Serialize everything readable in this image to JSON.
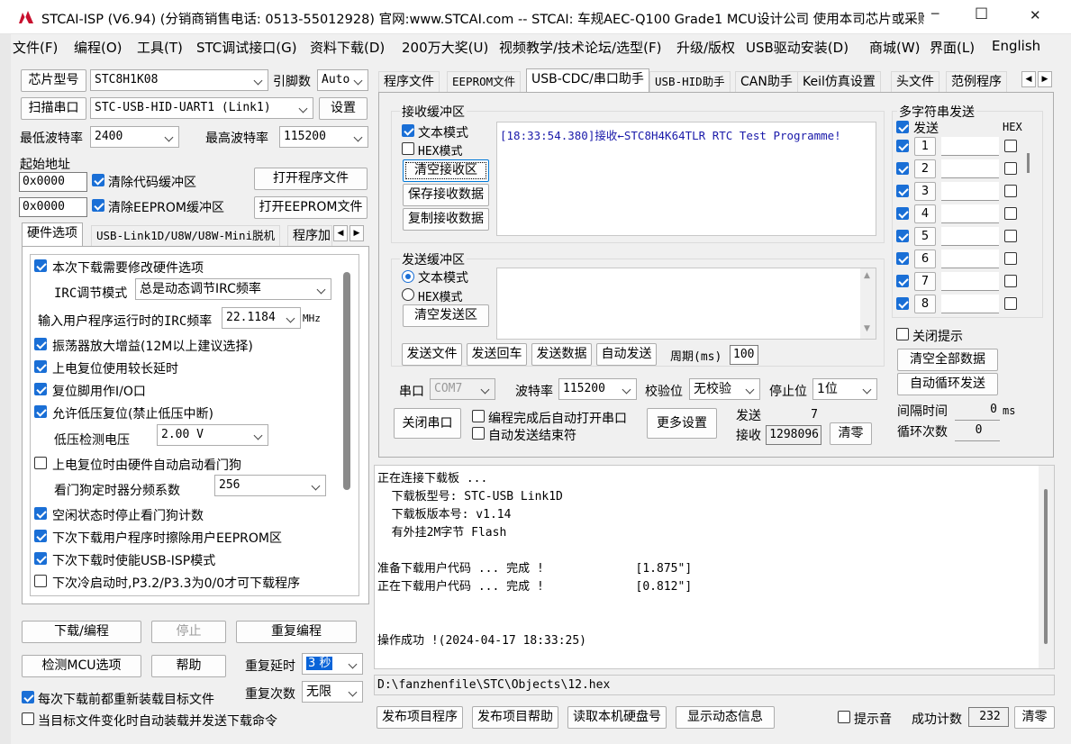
{
  "window": {
    "title": "STCAI-ISP (V6.94) (分销商销售电话: 0513-55012928) 官网:www.STCAI.com  -- STCAI: 车规AEC-Q100 Grade1 MCU设计公司 使用本司芯片或采购…",
    "app_icon": "stc-logo-icon",
    "minimize": "─",
    "maximize": "☐",
    "close": "✕"
  },
  "menu": [
    "文件(F)",
    "编程(O)",
    "工具(T)",
    "STC调试接口(G)",
    "资料下载(D)",
    "200万大奖(U)",
    "视频教学/技术论坛/选型(F)",
    "升级/版权",
    "USB驱动安装(D)",
    "商城(W)",
    "界面(L)",
    "English"
  ],
  "left": {
    "chip_label": "芯片型号",
    "chip_value": "STC8H1K08",
    "pins_label": "引脚数",
    "pins_value": "Auto",
    "scan_label": "扫描串口",
    "port_value": "STC-USB-HID-UART1 (Link1)",
    "settings_label": "设置",
    "min_baud_label": "最低波特率",
    "min_baud_value": "2400",
    "max_baud_label": "最高波特率",
    "max_baud_value": "115200",
    "start_addr_label": "起始地址",
    "addr1": "0x0000",
    "clear_code_label": "清除代码缓冲区",
    "open_prog_label": "打开程序文件",
    "addr2": "0x0000",
    "clear_eeprom_label": "清除EEPROM缓冲区",
    "open_eeprom_label": "打开EEPROM文件",
    "tabs": [
      "硬件选项",
      "USB-Link1D/U8W/U8W-Mini脱机",
      "程序加"
    ],
    "options": {
      "opt1": "本次下载需要修改硬件选项",
      "irc_mode_label": "IRC调节模式",
      "irc_mode_value": "总是动态调节IRC频率",
      "irc_freq_label": "输入用户程序运行时的IRC频率",
      "irc_freq_value": "22.1184",
      "irc_unit": "MHz",
      "opt2": "振荡器放大增益(12M以上建议选择)",
      "opt3": "上电复位使用较长延时",
      "opt4": "复位脚用作I/O口",
      "opt5": "允许低压复位(禁止低压中断)",
      "lvd_label": "低压检测电压",
      "lvd_value": "2.00 V",
      "opt6": "上电复位时由硬件自动启动看门狗",
      "wdt_label": "看门狗定时器分频系数",
      "wdt_value": "256",
      "opt7": "空闲状态时停止看门狗计数",
      "opt8": "下次下载用户程序时擦除用户EEPROM区",
      "opt9": "下次下载时使能USB-ISP模式",
      "opt10": "下次冷启动时,P3.2/P3.3为0/0才可下载程序"
    },
    "download_label": "下载/编程",
    "stop_label": "停止",
    "reprogram_label": "重复编程",
    "detect_label": "检测MCU选项",
    "help_label": "帮助",
    "repeat_delay_label": "重复延时",
    "repeat_delay_value": "3 秒",
    "repeat_count_label": "重复次数",
    "repeat_count_value": "无限",
    "reload_label": "每次下载前都重新装载目标文件",
    "auto_send_label": "当目标文件变化时自动装载并发送下载命令"
  },
  "right_tabs": [
    "程序文件",
    "EEPROM文件",
    "USB-CDC/串口助手",
    "USB-HID助手",
    "CAN助手",
    "Keil仿真设置",
    "头文件",
    "范例程序"
  ],
  "serial": {
    "recv_group": "接收缓冲区",
    "text_mode": "文本模式",
    "hex_mode": "HEX模式",
    "clear_recv": "清空接收区",
    "save_recv": "保存接收数据",
    "copy_recv": "复制接收数据",
    "recv_text": "[18:33:54.380]接收←STC8H4K64TLR RTC Test Programme!",
    "send_group": "发送缓冲区",
    "send_text_mode": "文本模式",
    "send_hex_mode": "HEX模式",
    "clear_send": "清空发送区",
    "send_file": "发送文件",
    "send_crlf": "发送回车",
    "send_data": "发送数据",
    "auto_send": "自动发送",
    "period_label": "周期(ms)",
    "period_value": "100",
    "port_label": "串口",
    "port_value": "COM7",
    "baud_label": "波特率",
    "baud_value": "115200",
    "parity_label": "校验位",
    "parity_value": "无校验",
    "stopbits_label": "停止位",
    "stopbits_value": "1位",
    "close_port": "关闭串口",
    "auto_open": "编程完成后自动打开串口",
    "auto_end": "自动发送结束符",
    "more_settings": "更多设置",
    "sent_label": "发送",
    "sent_value": "7",
    "recv_label": "接收",
    "recv_value": "1298096",
    "clear_counts": "清零"
  },
  "multi": {
    "group": "多字符串发送",
    "send_label": "发送",
    "hex_label": "HEX",
    "rows": [
      "1",
      "2",
      "3",
      "4",
      "5",
      "6",
      "7",
      "8"
    ],
    "close_tip": "关闭提示",
    "clear_all": "清空全部数据",
    "auto_loop": "自动循环发送",
    "interval_label": "间隔时间",
    "interval_value": "0",
    "interval_unit": "ms",
    "loop_label": "循环次数",
    "loop_value": "0"
  },
  "log": {
    "lines": [
      "正在连接下载板 ...",
      "  下载板型号: STC-USB Link1D",
      "  下载板版本号: v1.14",
      "  有外挂2M字节 Flash",
      "",
      "准备下载用户代码 ... 完成 !             [1.875\"]",
      "正在下载用户代码 ... 完成 !             [0.812\"]",
      "",
      "",
      "操作成功 !(2024-04-17 18:33:25)"
    ],
    "file_path": "D:\\fanzhenfile\\STC\\Objects\\12.hex"
  },
  "bottom": {
    "publish_prog": "发布项目程序",
    "publish_help": "发布项目帮助",
    "read_disk": "读取本机硬盘号",
    "show_dynamic": "显示动态信息",
    "beep_label": "提示音",
    "success_label": "成功计数",
    "success_value": "232",
    "clear_label": "清零"
  },
  "colors": {
    "accent": "#1a6fd6",
    "recv_text": "#1a1aaa"
  }
}
